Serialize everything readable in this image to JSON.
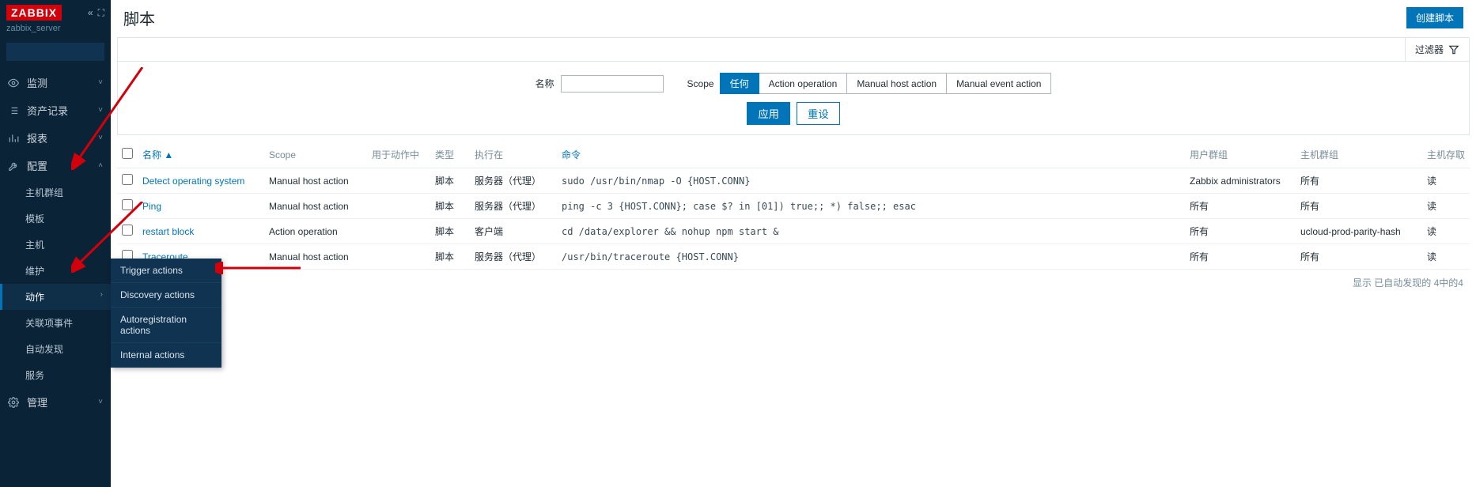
{
  "sidebar": {
    "logo": "ZABBIX",
    "server": "zabbix_server",
    "nav": [
      {
        "icon": "eye",
        "label": "监测"
      },
      {
        "icon": "list",
        "label": "资产记录"
      },
      {
        "icon": "chart",
        "label": "报表"
      },
      {
        "icon": "wrench",
        "label": "配置",
        "expanded": true
      }
    ],
    "config_sub": [
      "主机群组",
      "模板",
      "主机",
      "维护",
      "动作",
      "关联项事件",
      "自动发现",
      "服务"
    ],
    "admin": {
      "icon": "gear",
      "label": "管理"
    }
  },
  "flyout": [
    "Trigger actions",
    "Discovery actions",
    "Autoregistration actions",
    "Internal actions"
  ],
  "header": {
    "title": "脚本",
    "create_btn": "创建脚本"
  },
  "filter": {
    "tab_label": "过滤器",
    "name_label": "名称",
    "name_value": "",
    "scope_label": "Scope",
    "scope_options": [
      "任何",
      "Action operation",
      "Manual host action",
      "Manual event action"
    ],
    "apply": "应用",
    "reset": "重设"
  },
  "table": {
    "headers": [
      "名称 ▲",
      "Scope",
      "用于动作中",
      "类型",
      "执行在",
      "命令",
      "用户群组",
      "主机群组",
      "主机存取"
    ],
    "rows": [
      {
        "name": "Detect operating system",
        "scope": "Manual host action",
        "used": "",
        "type": "脚本",
        "exec": "服务器（代理）",
        "cmd": "sudo /usr/bin/nmap -O {HOST.CONN}",
        "ugroup": "Zabbix administrators",
        "hgroup": "所有",
        "access": "读"
      },
      {
        "name": "Ping",
        "scope": "Manual host action",
        "used": "",
        "type": "脚本",
        "exec": "服务器（代理）",
        "cmd": "ping -c 3 {HOST.CONN}; case $? in [01]) true;; *) false;; esac",
        "ugroup": "所有",
        "hgroup": "所有",
        "access": "读"
      },
      {
        "name": "restart block",
        "scope": "Action operation",
        "used": "",
        "type": "脚本",
        "exec": "客户端",
        "cmd": "cd /data/explorer && nohup npm start &",
        "ugroup": "所有",
        "hgroup": "ucloud-prod-parity-hash",
        "access": "读"
      },
      {
        "name": "Traceroute",
        "scope": "Manual host action",
        "used": "",
        "type": "脚本",
        "exec": "服务器（代理）",
        "cmd": "/usr/bin/traceroute {HOST.CONN}",
        "ugroup": "所有",
        "hgroup": "所有",
        "access": "读"
      }
    ]
  },
  "summary": "显示 已自动发现的 4中的4"
}
